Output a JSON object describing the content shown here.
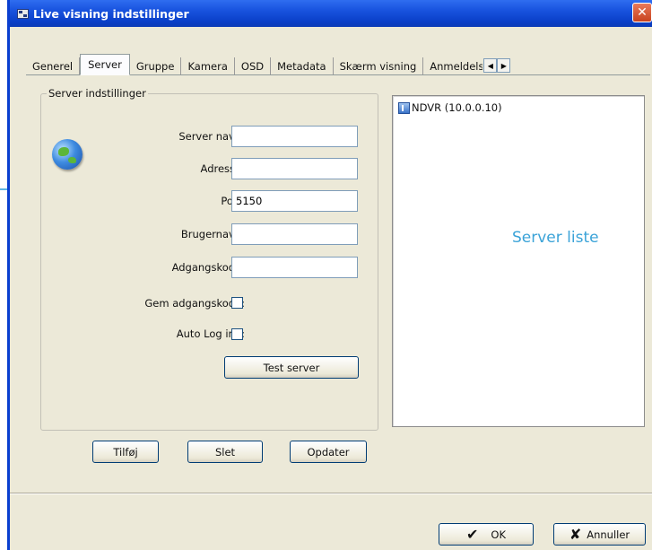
{
  "window": {
    "title": "Live visning indstillinger",
    "close_glyph": "✕"
  },
  "tabs": [
    {
      "label": "Generel"
    },
    {
      "label": "Server"
    },
    {
      "label": "Gruppe"
    },
    {
      "label": "Kamera"
    },
    {
      "label": "OSD"
    },
    {
      "label": "Metadata"
    },
    {
      "label": "Skærm visning"
    },
    {
      "label": "Anmeldelse"
    }
  ],
  "active_tab": "Server",
  "tab_scroll": {
    "left": "◀",
    "right": "▶"
  },
  "server_settings": {
    "group_title": "Server indstillinger",
    "server_name": {
      "label": "Server navn:",
      "value": ""
    },
    "address": {
      "label": "Adresse:",
      "value": ""
    },
    "port": {
      "label": "Port:",
      "value": "5150"
    },
    "username": {
      "label": "Brugernavn:",
      "value": ""
    },
    "password": {
      "label": "Adgangskode:",
      "value": ""
    },
    "remember_password": {
      "label": "Gem adgangskode:",
      "checked": false
    },
    "auto_login": {
      "label": "Auto Log ind:",
      "checked": false
    },
    "test_button": "Test server"
  },
  "server_list": {
    "items": [
      {
        "label": "NDVR (10.0.0.10)"
      }
    ],
    "annotation": "Server liste"
  },
  "list_buttons": {
    "add": "Tilføj",
    "delete": "Slet",
    "update": "Opdater"
  },
  "dialog_buttons": {
    "ok": "OK",
    "ok_glyph": "✔",
    "cancel": "Annuller",
    "cancel_glyph": "✘"
  }
}
